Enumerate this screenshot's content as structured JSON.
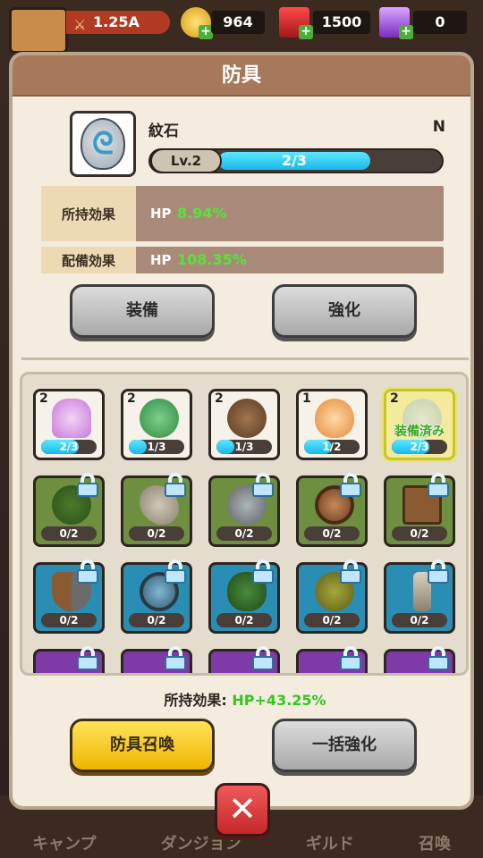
{
  "topbar": {
    "power": "1.25A",
    "gold": "964",
    "ruby": "1500",
    "gem": "0"
  },
  "colors": {
    "accent_green": "#54e637",
    "bar_blue": "#16b8ea",
    "title_brown": "#a7785a"
  },
  "dialog": {
    "title": "防具",
    "item": {
      "name": "紋石",
      "rank": "N",
      "icon": "swirl-stone-icon",
      "level": "Lv.2",
      "progress_text": "2/3",
      "progress": 0.67
    },
    "effects": [
      {
        "label": "所持効果",
        "stat": "HP",
        "value": "8.94%"
      },
      {
        "label": "配備効果",
        "stat": "HP",
        "value": "108.35%"
      }
    ],
    "buttons": {
      "equip": "装備",
      "enhance": "強化",
      "summon": "防具召喚",
      "bulk_enhance": "一括強化"
    },
    "total_label": "所持効果:",
    "total_value": "HP+43.25%",
    "grid": {
      "owned": [
        {
          "icon": "shell-icon",
          "level": "2",
          "count": "2/3",
          "fill": 0.67
        },
        {
          "icon": "turtle-shell-icon",
          "level": "2",
          "count": "1/3",
          "fill": 0.33
        },
        {
          "icon": "coconut-icon",
          "level": "2",
          "count": "1/3",
          "fill": 0.33
        },
        {
          "icon": "eggshell-icon",
          "level": "1",
          "count": "1/2",
          "fill": 0.5
        },
        {
          "icon": "swirl-stone-icon",
          "level": "2",
          "count": "2/3",
          "fill": 0.67,
          "equipped_label": "装備済み"
        }
      ],
      "locked_green": [
        {
          "icon": "leaf-shield-icon",
          "count": "0/2"
        },
        {
          "icon": "feather-icon",
          "count": "0/2"
        },
        {
          "icon": "pan-icon",
          "count": "0/2"
        },
        {
          "icon": "wheel-shield-icon",
          "count": "0/2"
        },
        {
          "icon": "crate-icon",
          "count": "0/2"
        }
      ],
      "locked_blue": [
        {
          "icon": "wood-shield-icon",
          "count": "0/2"
        },
        {
          "icon": "magnifier-icon",
          "count": "0/2"
        },
        {
          "icon": "clover-icon",
          "count": "0/2"
        },
        {
          "icon": "durian-icon",
          "count": "0/2"
        },
        {
          "icon": "bone-icon",
          "count": "0/2"
        }
      ]
    }
  },
  "background_nav": [
    "キャンプ",
    "ダンジョン",
    "ギルド",
    "召喚"
  ]
}
